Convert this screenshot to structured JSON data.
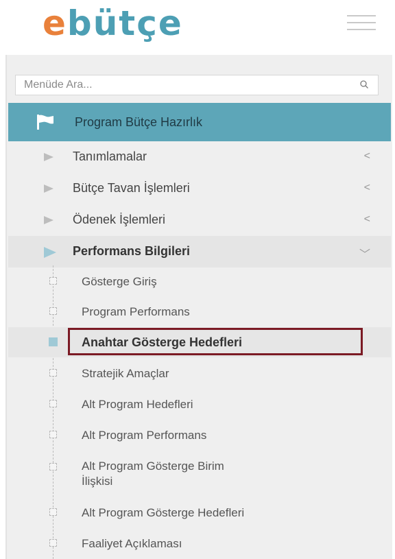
{
  "header": {
    "logo_part1": "e",
    "logo_part2": "bütçe",
    "menu_icon": "hamburger-icon"
  },
  "search": {
    "placeholder": "Menüde Ara...",
    "icon": "search-icon"
  },
  "section": {
    "label": "Program Bütçe Hazırlık",
    "icon": "flag-icon"
  },
  "menu": {
    "items": [
      {
        "label": "Tanımlamalar",
        "chevron": "<"
      },
      {
        "label": "Bütçe Tavan İşlemleri",
        "chevron": "<"
      },
      {
        "label": "Ödenek İşlemleri",
        "chevron": "<"
      },
      {
        "label": "Performans Bilgileri",
        "chevron": "﹀"
      }
    ],
    "sub_items": [
      {
        "label": "Gösterge Giriş"
      },
      {
        "label": "Program Performans"
      },
      {
        "label": "Anahtar Gösterge Hedefleri"
      },
      {
        "label": "Stratejik Amaçlar"
      },
      {
        "label": "Alt Program Hedefleri"
      },
      {
        "label": "Alt Program Performans"
      },
      {
        "label_line1": "Alt Program Gösterge Birim",
        "label_line2": "İlişkisi"
      },
      {
        "label": "Alt Program Gösterge Hedefleri"
      },
      {
        "label": "Faaliyet Açıklaması"
      }
    ]
  },
  "colors": {
    "logo_orange": "#e9813b",
    "logo_blue": "#4d9fb4",
    "section_bg": "#5da6b8",
    "highlight_border": "#7b1a24"
  }
}
